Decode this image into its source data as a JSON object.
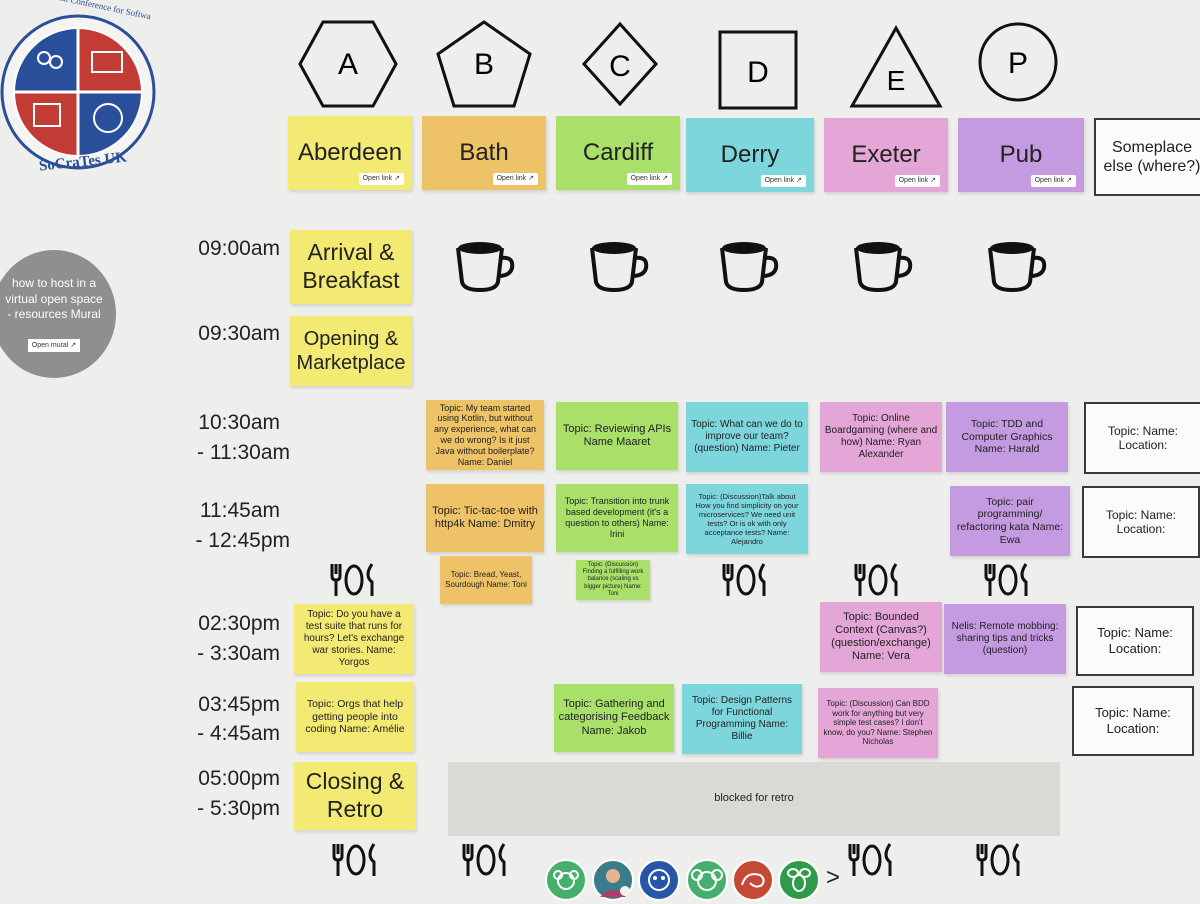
{
  "logo": {
    "arc_text": "International Conference for Software Craft and Testing",
    "name": "SoCraTes UK",
    "colors": [
      "#2a4f9a",
      "#c23b34",
      "#c23b34",
      "#2a4f9a"
    ]
  },
  "shapes": [
    {
      "letter": "A",
      "shape": "hexagon"
    },
    {
      "letter": "B",
      "shape": "pentagon"
    },
    {
      "letter": "C",
      "shape": "diamond"
    },
    {
      "letter": "D",
      "shape": "square"
    },
    {
      "letter": "E",
      "shape": "triangle"
    },
    {
      "letter": "P",
      "shape": "circle"
    }
  ],
  "rooms": [
    {
      "name": "Aberdeen",
      "open": "Open link ↗"
    },
    {
      "name": "Bath",
      "open": "Open link ↗"
    },
    {
      "name": "Cardiff",
      "open": "Open link ↗"
    },
    {
      "name": "Derry",
      "open": "Open link ↗"
    },
    {
      "name": "Exeter",
      "open": "Open link ↗"
    },
    {
      "name": "Pub",
      "open": "Open link ↗"
    },
    {
      "name": "Someplace else (where?)"
    }
  ],
  "help": {
    "text": "how to host in a virtual open space - resources Mural",
    "button": "Open mural ↗"
  },
  "times": [
    "09:00am",
    "09:30am",
    "10:30am",
    "- 11:30am",
    "11:45am",
    "- 12:45pm",
    "02:30pm",
    "- 3:30am",
    "03:45pm",
    "- 4:45am",
    "05:00pm",
    "- 5:30pm"
  ],
  "plenary": {
    "arrival": "Arrival & Breakfast",
    "opening": "Opening & Marketplace",
    "closing": "Closing & Retro",
    "blocked": "blocked for retro"
  },
  "sessions": {
    "b1": "Topic: My team started using Kotlin, but without any experience, what can we do wrong? Is it just Java without boilerplate? Name: Daniel",
    "c1": "Topic: Reviewing APIs Name Maaret",
    "d1": "Topic: What can we do to improve our team? (question) Name: Pieter",
    "e1": "Topic: Online Boardgaming (where and how) Name: Ryan Alexander",
    "p1": "Topic: TDD and Computer Graphics Name: Harald",
    "b2": "Topic: Tic-tac-toe with http4k Name: Dmitry",
    "c2": "Topic: Transition into trunk based development (it's a question to others) Name: Irini",
    "d2": "Topic: (Discussion)Talk about How you find simplicity on your microservices? We need unit tests? Or is ok with only acceptance tests? Name: Alejandro",
    "p2": "Topic: pair programming/ refactoring kata Name: Ewa",
    "b3": "Topic: Bread, Yeast, Sourdough Name: Toni",
    "c3": "Topic: (Discussion) Finding a fulfilling work balance (scaling vs bigger picture) Name: Toni",
    "a4": "Topic: Do you have a test suite that runs for hours? Let's exchange war stories. Name: Yorgos",
    "e4": "Topic: Bounded Context (Canvas?) (question/exchange) Name: Vera",
    "p4": "Nelis: Remote mobbing: sharing tips and tricks (question)",
    "a5": "Topic: Orgs that help getting people into coding Name: Amélie",
    "c5": "Topic: Gathering and categorising Feedback Name: Jakob",
    "d5": "Topic: Design Patterns for Functional Programming Name: Billie",
    "e5": "Topic: (Discussion) Can BDD work for anything but very simple test cases? I don't know, do you? Name: Stephen Nicholas"
  },
  "placeholder": "Topic: Name: Location:",
  "cursor_char": ">",
  "icons": {
    "coffee": "coffee-cup-icon",
    "meal": "fork-knife-icon"
  }
}
